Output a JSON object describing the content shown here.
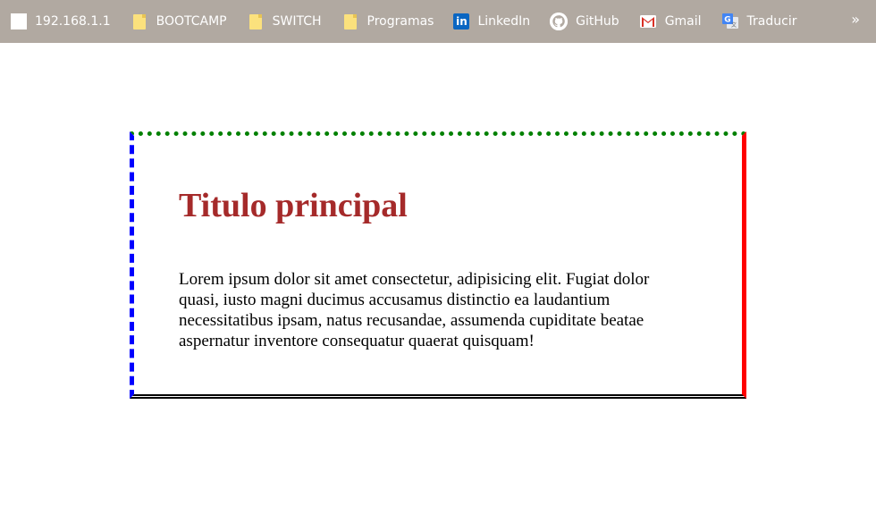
{
  "bookmarks": {
    "items": [
      {
        "label": "192.168.1.1",
        "icon": "blank-page-icon"
      },
      {
        "label": "BOOTCAMP",
        "icon": "folder-icon"
      },
      {
        "label": "SWITCH",
        "icon": "folder-icon"
      },
      {
        "label": "Programas",
        "icon": "folder-icon"
      },
      {
        "label": "LinkedIn",
        "icon": "linkedin-icon"
      },
      {
        "label": "GitHub",
        "icon": "github-icon"
      },
      {
        "label": "Gmail",
        "icon": "gmail-icon"
      },
      {
        "label": "Traducir",
        "icon": "google-translate-icon"
      }
    ],
    "more_label": "»"
  },
  "content": {
    "title": "Titulo principal",
    "paragraph": "Lorem ipsum dolor sit amet consectetur, adipisicing elit. Fugiat dolor quasi, iusto magni ducimus accusamus distinctio ea laudantium necessitatibus ipsam, natus recusandae, assumenda cupiditate beatae aspernatur inventore consequatur quaerat quisquam!"
  },
  "colors": {
    "bookmarks_bar": "#b1a9a1",
    "title": "#a52a2a",
    "border_top": "#008000",
    "border_left": "#0000ff",
    "border_right": "#ff0000",
    "border_bottom": "#000000"
  }
}
